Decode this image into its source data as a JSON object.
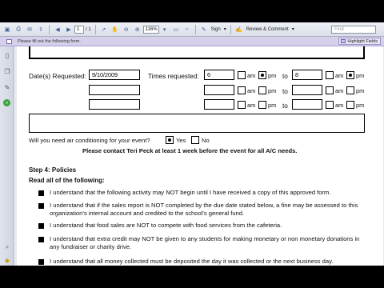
{
  "toolbar": {
    "page_current": "1",
    "page_total": "/ 1",
    "zoom": "116%",
    "sign_label": "Sign",
    "review_label": "Review & Comment",
    "find_placeholder": "Find"
  },
  "notice": {
    "text": "Please fill out the following form.",
    "highlight_label": "Highlight Fields"
  },
  "form": {
    "dates_label": "Date(s) Requested:",
    "date1": "9/10/2009",
    "times_label": "Times requested:",
    "time1_start": "6",
    "time1_end": "8",
    "am": "am",
    "pm": "pm",
    "to": "to",
    "ac_question": "Will you need air conditioning for your event?",
    "yes": "Yes",
    "no": "No",
    "ac_notice": "Please contact Teri Peck at least 1 week before the event for all A/C needs.",
    "step_title": "Step 4: Policies",
    "read_all": "Read all of the following:",
    "policies": [
      "I understand that the following activity may NOT begin until I have received a copy of this approved form.",
      "I understand that if the sales report is NOT completed by the due date stated below, a fine may be assessed to this organization's  internal account and credited to the school's general fund.",
      "I understand that food sales are NOT to compete with food services from the cafeteria.",
      "I understand that extra credit may NOT be given to any students for making monetary or non monetary donations in any fundraiser or charity drive.",
      "I understand that all money collected must be deposited the day it was collected or the next business day."
    ]
  }
}
